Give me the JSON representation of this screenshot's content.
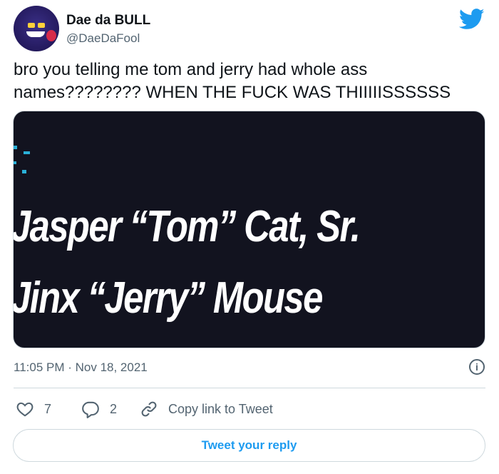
{
  "author": {
    "display_name": "Dae da BULL",
    "handle": "@DaeDaFool",
    "avatar_icon": "purple-character-avatar"
  },
  "tweet": {
    "text": "bro you telling me tom and jerry had whole ass names???????? WHEN THE FUCK WAS THIIIIISSSSSS",
    "media": {
      "line1": "Jasper “Tom” Cat, Sr.",
      "line2": "Jinx “Jerry” Mouse"
    },
    "timestamp": "11:05 PM · Nov 18, 2021"
  },
  "actions": {
    "like_count": "7",
    "reply_count": "2",
    "copy_label": "Copy link to Tweet"
  },
  "reply_button": {
    "label": "Tweet your reply"
  },
  "colors": {
    "accent": "#1d9bf0",
    "muted": "#536471",
    "media_bg": "#12131f"
  },
  "icons": [
    "twitter-bird-icon",
    "info-icon",
    "heart-icon",
    "reply-icon",
    "link-icon"
  ]
}
